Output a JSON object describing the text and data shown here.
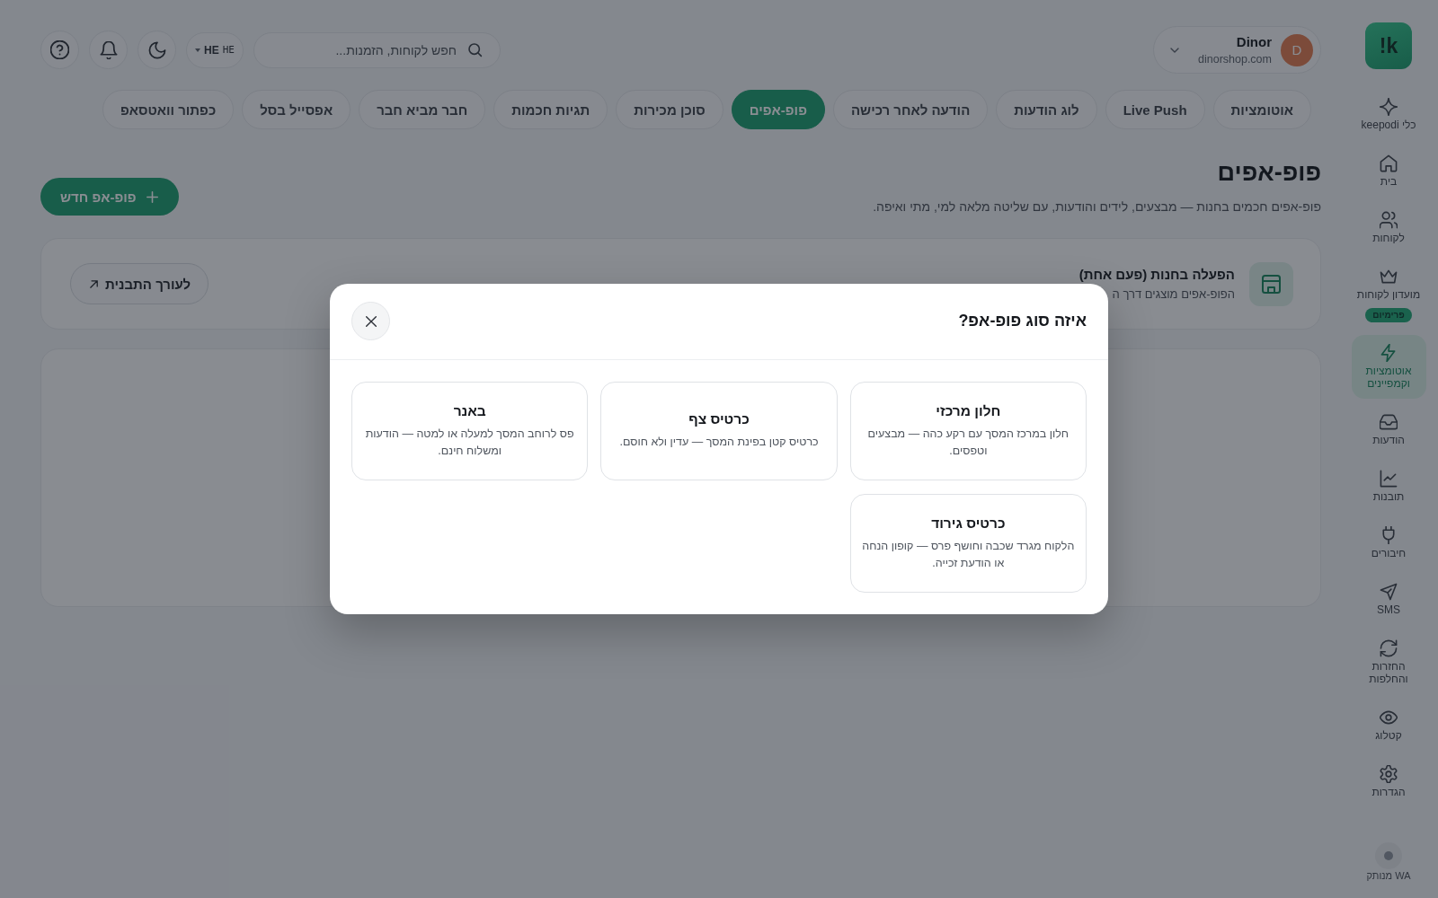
{
  "sidebar": {
    "logo": "!k",
    "items": [
      {
        "label": "כלי keepodi",
        "selected": false
      },
      {
        "label": "בית",
        "selected": false
      },
      {
        "label": "לקוחות",
        "selected": false
      },
      {
        "label": "מועדון לקוחות",
        "selected": false,
        "badge": "פרימיום"
      },
      {
        "label": "אוטומציות וקמפיינים",
        "selected": true
      },
      {
        "label": "הודעות",
        "selected": false
      },
      {
        "label": "תובנות",
        "selected": false
      },
      {
        "label": "חיבורים",
        "selected": false
      },
      {
        "label": "SMS",
        "selected": false
      },
      {
        "label": "החזרות והחלפות",
        "selected": false
      },
      {
        "label": "קטלוג",
        "selected": false
      },
      {
        "label": "הגדרות",
        "selected": false
      }
    ],
    "status": {
      "label": "WA מנותק",
      "connected": false
    }
  },
  "header": {
    "account": {
      "initial": "D",
      "name": "Dinor",
      "domain": "dinorshop.com"
    },
    "search": {
      "placeholder": "חפש לקוחות, הזמנות..."
    },
    "language": {
      "flag": "HE",
      "code": "HE"
    }
  },
  "tabs": [
    {
      "label": "אוטומציות",
      "selected": false
    },
    {
      "label": "Live Push",
      "selected": false
    },
    {
      "label": "לוג הודעות",
      "selected": false
    },
    {
      "label": "הודעה לאחר רכישה",
      "selected": false
    },
    {
      "label": "פופ-אפים",
      "selected": true
    },
    {
      "label": "סוכן מכירות",
      "selected": false
    },
    {
      "label": "תגיות חכמות",
      "selected": false
    },
    {
      "label": "חבר מביא חבר",
      "selected": false
    },
    {
      "label": "אפסייל בסל",
      "selected": false
    },
    {
      "label": "כפתור וואטסאפ",
      "selected": false
    }
  ],
  "page": {
    "title": "פופ-אפים",
    "subtitle": "פופ-אפים חכמים בחנות — מבצעים, לידים והודעות, עם שליטה מלאה למי, מתי ואיפה.",
    "new_button": "פופ-אפ חדש"
  },
  "activation_card": {
    "title": "הפעלה בחנות (פעם אחת)",
    "subtitle": "הפופ-אפים מוצגים דרך ה",
    "button": "לעורך התבנית"
  },
  "modal": {
    "title": "איזה סוג פופ-אפ?",
    "options": [
      {
        "title": "חלון מרכזי",
        "description": "חלון במרכז המסך עם רקע כהה — מבצעים וטפסים."
      },
      {
        "title": "כרטיס צף",
        "description": "כרטיס קטן בפינת המסך — עדין ולא חוסם."
      },
      {
        "title": "באנר",
        "description": "פס לרוחב המסך למעלה או למטה — הודעות ומשלוח חינם."
      },
      {
        "title": "כרטיס גירוד",
        "description": "הלקוח מגרד שכבה וחושף פרס — קופון הנחה או הודעת זכייה."
      }
    ]
  }
}
